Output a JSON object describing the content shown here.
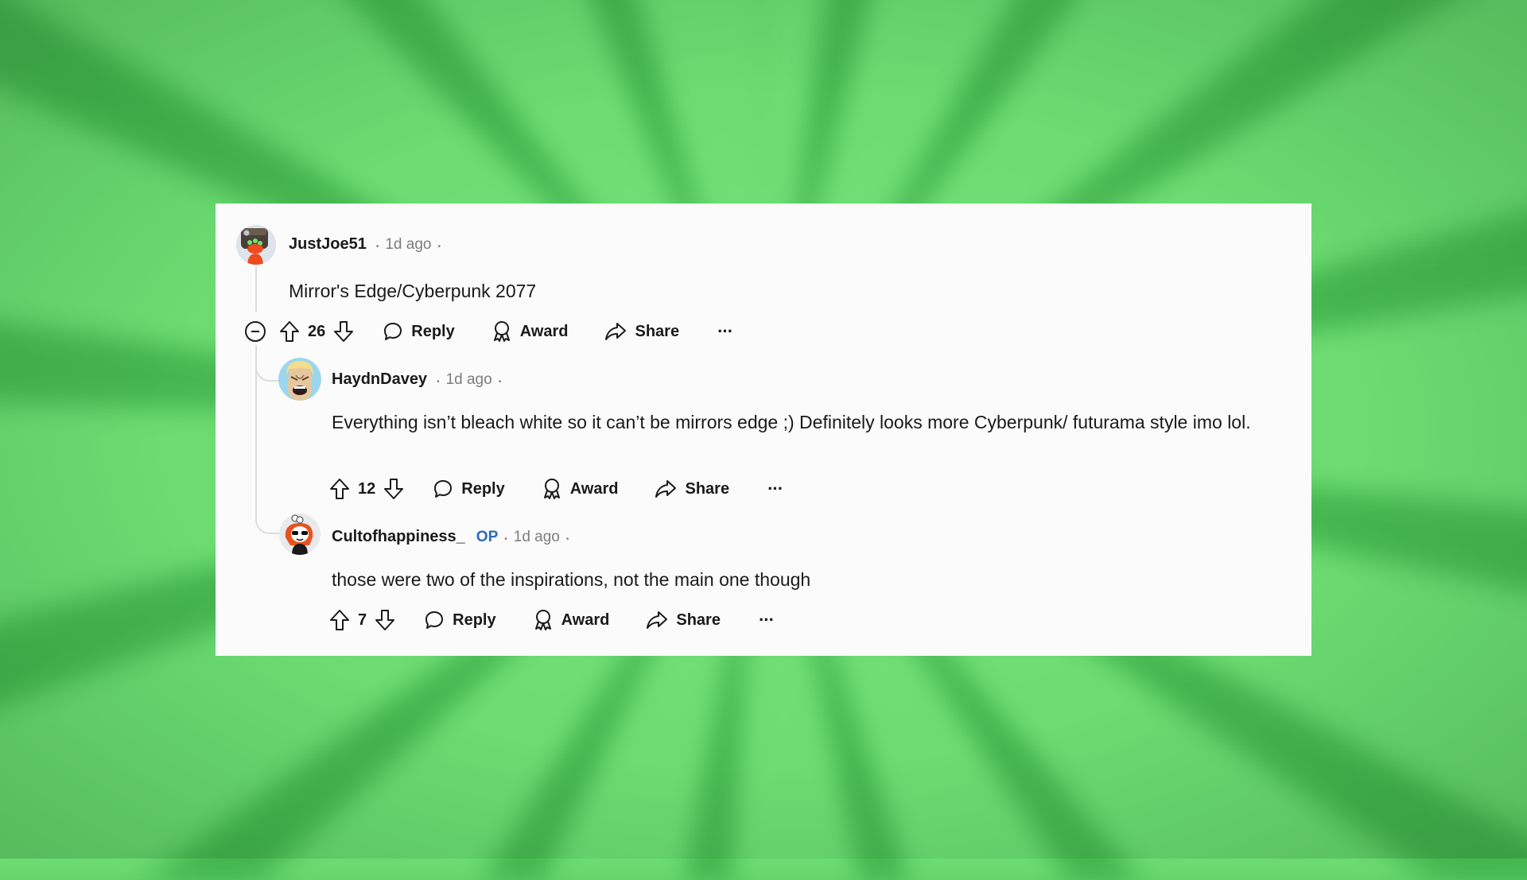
{
  "comments": [
    {
      "username": "JustJoe51",
      "is_op": false,
      "time": "1d ago",
      "body": "Mirror's Edge/Cyberpunk 2077",
      "score": "26",
      "avatar": "robot-helmet-avatar"
    },
    {
      "username": "HaydnDavey",
      "is_op": false,
      "time": "1d ago",
      "body": "Everything isn’t bleach white so it can’t be mirrors edge ;) Definitely looks more Cyberpunk/ futurama style imo lol.",
      "score": "12",
      "avatar": "angry-blonde-man-avatar"
    },
    {
      "username": "Cultofhappiness_",
      "is_op": true,
      "op_label": "OP",
      "time": "1d ago",
      "body": "those were two of the inspirations, not the main one though",
      "score": "7",
      "avatar": "red-hair-sunglasses-avatar"
    }
  ],
  "actions": {
    "reply": "Reply",
    "award": "Award",
    "share": "Share",
    "more": "···"
  },
  "separator": "•",
  "colors": {
    "op": "#2a6bbd",
    "card_bg": "#fbfbfb",
    "text": "#1a1a1b",
    "meta": "#7c7c7c",
    "background": "#5ccc66"
  }
}
